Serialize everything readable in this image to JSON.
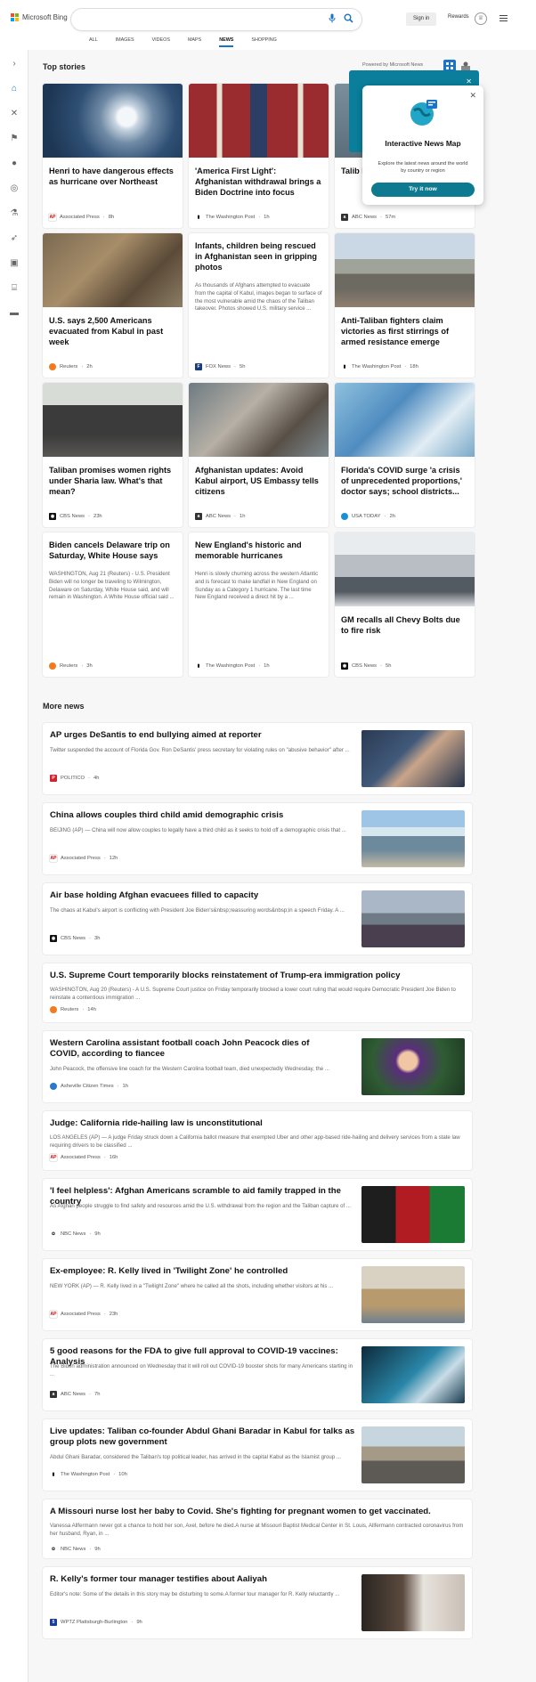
{
  "header": {
    "brand": "Microsoft Bing",
    "sign_in": "Sign in",
    "rewards": "Rewards",
    "tabs": [
      "ALL",
      "IMAGES",
      "VIDEOS",
      "MAPS",
      "NEWS",
      "SHOPPING"
    ],
    "active_tab": "NEWS"
  },
  "top_stories": {
    "title": "Top stories",
    "powered_by": "Powered by Microsoft News",
    "cards": [
      {
        "headline": "Henri to have dangerous effects as hurricane over Northeast",
        "source": "Associated Press",
        "time": "8h"
      },
      {
        "headline": "'America First Light': Afghanistan withdrawal brings a Biden Doctrine into focus",
        "source": "The Washington Post",
        "time": "1h"
      },
      {
        "headline": "Talib black offici",
        "source": "ABC News",
        "time": "57m"
      },
      {
        "headline": "U.S. says 2,500 Americans evacuated from Kabul in past week",
        "source": "Reuters",
        "time": "2h"
      },
      {
        "headline": "Infants, children being rescued in Afghanistan seen in gripping photos",
        "desc": "As thousands of Afghans attempted to evacuate from the capital of Kabul, images began to surface of the most vulnerable amid the chaos of the Taliban takeover. Photos showed U.S. military service ...",
        "source": "FOX News",
        "time": "5h"
      },
      {
        "headline": "Anti-Taliban fighters claim victories as first stirrings of armed resistance emerge",
        "source": "The Washington Post",
        "time": "18h"
      },
      {
        "headline": "Taliban promises women rights under Sharia law. What's that mean?",
        "source": "CBS News",
        "time": "23h"
      },
      {
        "headline": "Afghanistan updates: Avoid Kabul airport, US Embassy tells citizens",
        "source": "ABC News",
        "time": "1h"
      },
      {
        "headline": "Florida's COVID surge 'a crisis of unprecedented proportions,' doctor says; school districts...",
        "source": "USA TODAY",
        "time": "2h"
      },
      {
        "headline": "Biden cancels Delaware trip on Saturday, White House says",
        "desc": "WASHINGTON, Aug 21 (Reuters) - U.S. President Biden will no longer be traveling to Wilmington, Delaware on Saturday, White House said, and will remain in Washington. A White House official said ...",
        "source": "Reuters",
        "time": "3h"
      },
      {
        "headline": "New England's historic and memorable hurricanes",
        "desc": "Henri is slowly churning across the western Atlantic and is forecast to make landfall in New England on Sunday as a Category 1 hurricane. The last time New England received a direct hit by a ...",
        "source": "The Washington Post",
        "time": "1h"
      },
      {
        "headline": "GM recalls all Chevy Bolts due to fire risk",
        "source": "CBS News",
        "time": "5h"
      }
    ]
  },
  "popup": {
    "title": "Interactive News Map",
    "desc": "Explore the latest news around the world by country or region",
    "button": "Try it now"
  },
  "more_news": {
    "title": "More news",
    "items": [
      {
        "headline": "AP urges DeSantis to end bullying aimed at reporter",
        "desc": "Twitter suspended the account of Florida Gov. Ron DeSantis' press secretary for violating rules on \"abusive behavior\" after ...",
        "source": "POLITICO",
        "time": "4h"
      },
      {
        "headline": "China allows couples third child amid demographic crisis",
        "desc": "BEIJING (AP) — China will now allow couples to legally have a third child as it seeks to hold off a demographic crisis that ...",
        "source": "Associated Press",
        "time": "12h"
      },
      {
        "headline": "Air base holding Afghan evacuees filled to capacity",
        "desc": "The chaos at Kabul's airport is conflicting with President Joe Biden's&nbsp;reassuring words&nbsp;in a speech Friday. A ...",
        "source": "CBS News",
        "time": "3h"
      },
      {
        "headline": "U.S. Supreme Court temporarily blocks reinstatement of Trump-era immigration policy",
        "desc": "WASHINGTON, Aug 20 (Reuters) - A U.S. Supreme Court justice on Friday temporarily blocked a lower court ruling that would require Democratic President Joe Biden to reinstate a contentious immigration ...",
        "source": "Reuters",
        "time": "14h"
      },
      {
        "headline": "Western Carolina assistant football coach John Peacock dies of COVID, according to fiancee",
        "desc": "John Peacock, the offensive line coach for the Western Carolina football team, died unexpectedly Wednesday, the ...",
        "source": "Asheville Citizen Times",
        "time": "1h"
      },
      {
        "headline": "Judge: California ride-hailing law is unconstitutional",
        "desc": "LOS ANGELES (AP) — A judge Friday struck down a California ballot measure that exempted Uber and other app-based ride-hailing and delivery services from a state law requiring drivers to be classified ...",
        "source": "Associated Press",
        "time": "16h"
      },
      {
        "headline": "'I feel helpless': Afghan Americans scramble to aid family trapped in the country",
        "desc": "As Afghan people struggle to find safety and resources amid the U.S. withdrawal from the region and the Taliban capture of ...",
        "source": "NBC News",
        "time": "9h"
      },
      {
        "headline": "Ex-employee: R. Kelly lived in 'Twilight Zone' he controlled",
        "desc": "NEW YORK (AP) — R. Kelly lived in a \"Twilight Zone\" where he called all the shots, including whether visitors at his ...",
        "source": "Associated Press",
        "time": "23h"
      },
      {
        "headline": "5 good reasons for the FDA to give full approval to COVID-19 vaccines: Analysis",
        "desc": "The Biden administration announced on Wednesday that it will roll out COVID-19 booster shots for many Americans starting in ...",
        "source": "ABC News",
        "time": "7h"
      },
      {
        "headline": "Live updates: Taliban co-founder Abdul Ghani Baradar in Kabul for talks as group plots new government",
        "desc": "Abdul Ghani Baradar, considered the Taliban's top political leader, has arrived in the capital Kabul as the Islamist group ...",
        "source": "The Washington Post",
        "time": "10h"
      },
      {
        "headline": "A Missouri nurse lost her baby to Covid. She's fighting for pregnant women to get vaccinated.",
        "desc": "Vanessa Allfermann never got a chance to hold her son, Axel, before he died.A nurse at Missouri Baptist Medical Center in St. Louis, Allfermann contracted coronavirus from her husband, Ryan, in ...",
        "source": "NBC News",
        "time": "9h"
      },
      {
        "headline": "R. Kelly's former tour manager testifies about Aaliyah",
        "desc": "Editor's note: Some of the details in this story may be disturbing to some.A former tour manager for R. Kelly reluctantly ...",
        "source": "WPTZ Plattsburgh-Burlington",
        "time": "9h"
      }
    ]
  },
  "colors": {
    "accent": "#1a73c8",
    "teal": "#0e7a91"
  }
}
